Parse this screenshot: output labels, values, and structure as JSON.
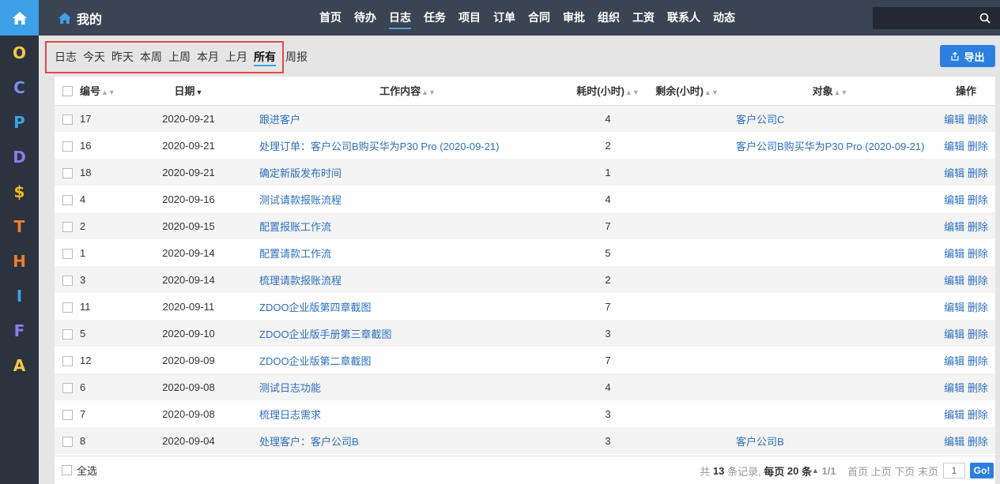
{
  "rail": {
    "letters": [
      {
        "t": "O",
        "c": "#f5c842"
      },
      {
        "t": "C",
        "c": "#7b8cf0"
      },
      {
        "t": "P",
        "c": "#3ea1e8"
      },
      {
        "t": "D",
        "c": "#8a7cf0"
      },
      {
        "t": "$",
        "c": "#f5b820"
      },
      {
        "t": "T",
        "c": "#f07e30"
      },
      {
        "t": "H",
        "c": "#f07e30"
      },
      {
        "t": "I",
        "c": "#3ea1e8"
      },
      {
        "t": "F",
        "c": "#8a7cf0"
      },
      {
        "t": "A",
        "c": "#f5c842"
      }
    ]
  },
  "topbar": {
    "title": "我的",
    "nav": [
      "首页",
      "待办",
      "日志",
      "任务",
      "项目",
      "订单",
      "合同",
      "审批",
      "组织",
      "工资",
      "联系人",
      "动态"
    ],
    "active": 2
  },
  "submenu": {
    "items": [
      "日志",
      "今天",
      "昨天",
      "本周",
      "上周",
      "本月",
      "上月",
      "所有"
    ],
    "active": 7,
    "after": "周报"
  },
  "export_label": "导出",
  "table": {
    "headers": {
      "id": "编号",
      "date": "日期",
      "content": "工作内容",
      "cost": "耗时(小时)",
      "left": "剩余(小时)",
      "object": "对象",
      "actions": "操作"
    },
    "edit_label": "编辑",
    "delete_label": "删除",
    "rows": [
      {
        "id": "17",
        "date": "2020-09-21",
        "content": "跟进客户",
        "cost": "4",
        "object": "客户公司C"
      },
      {
        "id": "16",
        "date": "2020-09-21",
        "content": "处理订单：客户公司B购买华为P30 Pro (2020-09-21)",
        "cost": "2",
        "object": "客户公司B购买华为P30 Pro (2020-09-21)"
      },
      {
        "id": "18",
        "date": "2020-09-21",
        "content": "确定新版发布时间",
        "cost": "1",
        "object": ""
      },
      {
        "id": "4",
        "date": "2020-09-16",
        "content": "测试请款报账流程",
        "cost": "4",
        "object": ""
      },
      {
        "id": "2",
        "date": "2020-09-15",
        "content": "配置报账工作流",
        "cost": "7",
        "object": ""
      },
      {
        "id": "1",
        "date": "2020-09-14",
        "content": "配置请款工作流",
        "cost": "5",
        "object": ""
      },
      {
        "id": "3",
        "date": "2020-09-14",
        "content": "梳理请款报账流程",
        "cost": "2",
        "object": ""
      },
      {
        "id": "11",
        "date": "2020-09-11",
        "content": "ZDOO企业版第四章截图",
        "cost": "7",
        "object": ""
      },
      {
        "id": "5",
        "date": "2020-09-10",
        "content": "ZDOO企业版手册第三章截图",
        "cost": "3",
        "object": ""
      },
      {
        "id": "12",
        "date": "2020-09-09",
        "content": "ZDOO企业版第二章截图",
        "cost": "7",
        "object": ""
      },
      {
        "id": "6",
        "date": "2020-09-08",
        "content": "测试日志功能",
        "cost": "4",
        "object": ""
      },
      {
        "id": "7",
        "date": "2020-09-08",
        "content": "梳理日志需求",
        "cost": "3",
        "object": ""
      },
      {
        "id": "8",
        "date": "2020-09-04",
        "content": "处理客户：客户公司B",
        "cost": "3",
        "object": "客户公司B"
      }
    ]
  },
  "footer": {
    "select_all": "全选",
    "total_pre": "共",
    "total": "13",
    "total_post": "条记录,",
    "per_page_pre": "每页",
    "per_page": "20",
    "per_page_post": "条",
    "page_info": "1/1",
    "first": "首页",
    "prev": "上页",
    "next": "下页",
    "last": "末页",
    "page_input": "1",
    "go": "Go!"
  },
  "colors": {
    "accent": "#3ea1e8",
    "button": "#2b7fe0",
    "link": "#2c6fc0",
    "highlight_box": "#e64848"
  }
}
